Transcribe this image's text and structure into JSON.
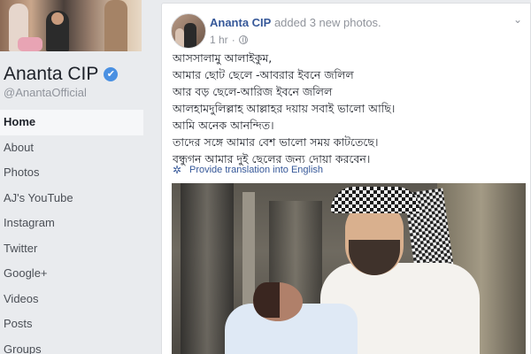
{
  "sidebar": {
    "page_name": "Ananta CIP",
    "handle": "@AnantaOfficial",
    "verified_glyph": "✔",
    "nav_items": [
      {
        "label": "Home",
        "active": true
      },
      {
        "label": "About",
        "active": false
      },
      {
        "label": "Photos",
        "active": false
      },
      {
        "label": "AJ's YouTube",
        "active": false
      },
      {
        "label": "Instagram",
        "active": false
      },
      {
        "label": "Twitter",
        "active": false
      },
      {
        "label": "Google+",
        "active": false
      },
      {
        "label": "Videos",
        "active": false
      },
      {
        "label": "Posts",
        "active": false
      },
      {
        "label": "Groups",
        "active": false
      }
    ]
  },
  "post": {
    "author": "Ananta CIP",
    "action": " added 3 new photos.",
    "time": "1 hr",
    "separator": "·",
    "more_glyph": "⌄",
    "lines": [
      "আসসালামু আলাইকুম,",
      "আমার ছোট ছেলে -আবরার ইবনে জলিল",
      "আর বড় ছেলে-আরিজ ইবনে জলিল",
      "আলহামদুলিল্লাহ আল্লাহর দয়ায় সবাই ভালো আছি।",
      "আমি অনেক আনন্দিত।",
      "তাদের সঙ্গে আমার বেশ ভালো সময় কাটতেছে।",
      "বন্ধুগন আমার দুই ছেলের জন্য দোয়া করবেন।"
    ],
    "translate_label": "Provide translation into English",
    "gear_glyph": "✲"
  },
  "colors": {
    "link": "#365899",
    "verified": "#4a90e2",
    "background": "#e9ebee"
  },
  "icons": [
    "verified-badge-icon",
    "globe-icon",
    "gear-icon",
    "chevron-down-icon"
  ]
}
